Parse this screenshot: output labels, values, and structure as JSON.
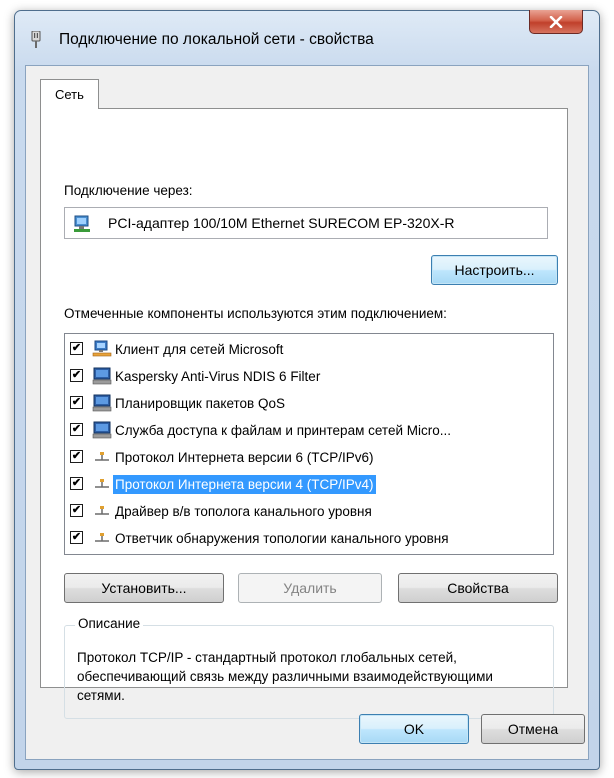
{
  "window": {
    "title": "Подключение по локальной сети - свойства",
    "close_label": "✕"
  },
  "tabs": [
    {
      "label": "Сеть"
    }
  ],
  "connect_via": {
    "label": "Подключение через:",
    "adapter": "PCI-адаптер 100/10M Ethernet SURECOM EP-320X-R",
    "configure_button": "Настроить..."
  },
  "components": {
    "label": "Отмеченные компоненты используются этим подключением:",
    "items": [
      {
        "label": "Клиент для сетей Microsoft",
        "checked": "✔",
        "icon": "network-client-icon"
      },
      {
        "label": "Kaspersky Anti-Virus NDIS 6 Filter",
        "checked": "✔",
        "icon": "computer-service-icon"
      },
      {
        "label": "Планировщик пакетов QoS",
        "checked": "✔",
        "icon": "computer-service-icon"
      },
      {
        "label": "Служба доступа к файлам и принтерам сетей Micro...",
        "checked": "✔",
        "icon": "computer-service-icon"
      },
      {
        "label": "Протокол Интернета версии 6 (TCP/IPv6)",
        "checked": "✔",
        "icon": "protocol-icon"
      },
      {
        "label": "Протокол Интернета версии 4 (TCP/IPv4)",
        "checked": "✔",
        "icon": "protocol-icon",
        "selected": true
      },
      {
        "label": "Драйвер в/в тополога канального уровня",
        "checked": "✔",
        "icon": "protocol-icon"
      },
      {
        "label": "Ответчик обнаружения топологии канального уровня",
        "checked": "✔",
        "icon": "protocol-icon"
      }
    ]
  },
  "actions": {
    "install": "Установить...",
    "remove": "Удалить",
    "properties": "Свойства"
  },
  "description": {
    "legend": "Описание",
    "text": "Протокол TCP/IP - стандартный протокол глобальных сетей, обеспечивающий связь между различными взаимодействующими сетями."
  },
  "footer": {
    "ok": "OK",
    "cancel": "Отмена"
  },
  "colors": {
    "selection": "#3399ff",
    "close_button": "#c7432f",
    "title_bar": "#c9daee"
  }
}
